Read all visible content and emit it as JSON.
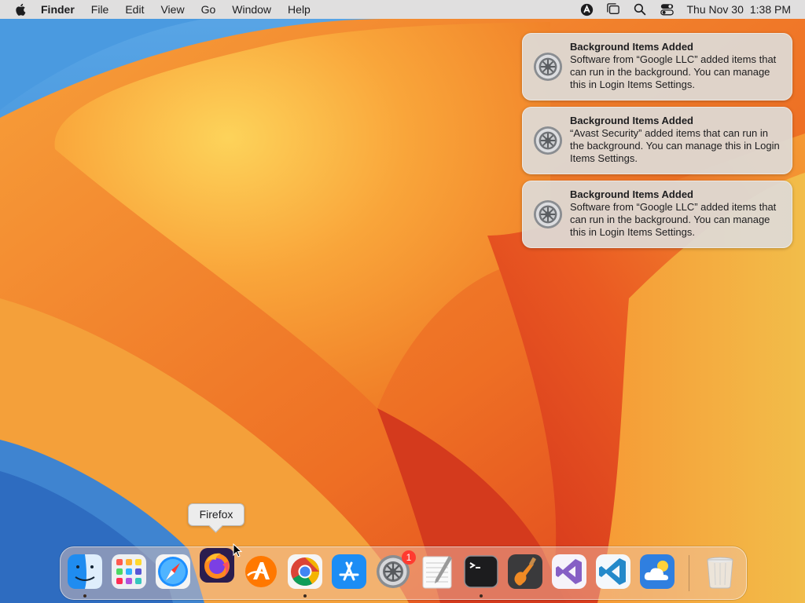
{
  "menubar": {
    "app_name": "Finder",
    "menus": [
      "File",
      "Edit",
      "View",
      "Go",
      "Window",
      "Help"
    ],
    "status_icons": [
      "avast-icon",
      "stage-manager-icon",
      "spotlight-search-icon",
      "control-center-icon"
    ],
    "clock": {
      "day": "Thu Nov 30",
      "time": "1:38 PM"
    }
  },
  "notifications": [
    {
      "title": "Background Items Added",
      "body": "Software from “Google LLC” added items that can run in the background. You can manage this in Login Items Settings.",
      "icon": "system-settings-gear-icon"
    },
    {
      "title": "Background Items Added",
      "body": "“Avast Security” added items that can run in the background. You can manage this in Login Items Settings.",
      "icon": "system-settings-gear-icon"
    },
    {
      "title": "Background Items Added",
      "body": "Software from “Google LLC” added items that can run in the background. You can manage this in Login Items Settings.",
      "icon": "system-settings-gear-icon"
    }
  ],
  "dock": {
    "tooltip": "Firefox",
    "items": [
      {
        "name": "Finder",
        "icon": "finder-icon",
        "running": true
      },
      {
        "name": "Launchpad",
        "icon": "launchpad-icon",
        "running": false
      },
      {
        "name": "Safari",
        "icon": "safari-icon",
        "running": false
      },
      {
        "name": "Firefox",
        "icon": "firefox-icon",
        "running": false
      },
      {
        "name": "Avast",
        "icon": "avast-icon",
        "running": false
      },
      {
        "name": "Google Chrome",
        "icon": "chrome-icon",
        "running": true
      },
      {
        "name": "App Store",
        "icon": "app-store-icon",
        "running": false
      },
      {
        "name": "System Settings",
        "icon": "system-settings-icon",
        "running": false,
        "badge": "1"
      },
      {
        "name": "TextEdit",
        "icon": "textedit-icon",
        "running": false
      },
      {
        "name": "Terminal",
        "icon": "terminal-icon",
        "running": true
      },
      {
        "name": "GarageBand",
        "icon": "garageband-icon",
        "running": false
      },
      {
        "name": "Visual Studio",
        "icon": "visual-studio-icon",
        "running": false
      },
      {
        "name": "Visual Studio Code",
        "icon": "vscode-icon",
        "running": false
      },
      {
        "name": "Weather",
        "icon": "weather-icon",
        "running": false
      },
      {
        "name": "Trash",
        "icon": "trash-icon",
        "running": false
      }
    ]
  },
  "colors": {
    "wallpaper_light": "#fbc24a",
    "wallpaper_mid": "#f3892b",
    "wallpaper_dark": "#d9361f",
    "wallpaper_sky": "#3d8ed8",
    "badge": "#ff3b30"
  }
}
